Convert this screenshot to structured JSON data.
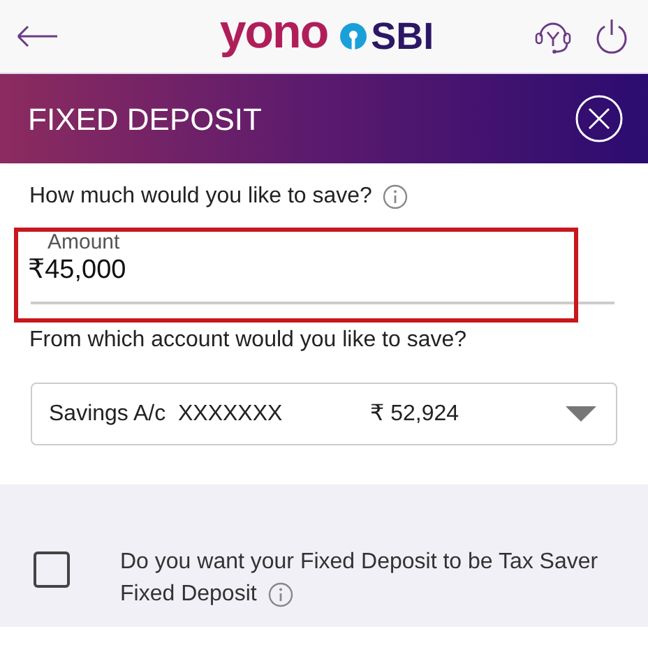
{
  "header": {
    "logo_primary": "yono",
    "logo_secondary": "SBI"
  },
  "banner": {
    "title": "FIXED DEPOSIT"
  },
  "amount": {
    "question": "How much would you like to save?",
    "label": "Amount",
    "currency": "₹",
    "value": "45,000",
    "highlighted": true
  },
  "account": {
    "question": "From which account would you like to save?",
    "name": "Savings A/c",
    "number": "XXXXXXX",
    "balance": "₹ 52,924"
  },
  "tax_saver": {
    "label_lines": [
      "Do you want your Fixed Deposit to be Tax Saver",
      "Fixed Deposit"
    ],
    "checked": false
  }
}
